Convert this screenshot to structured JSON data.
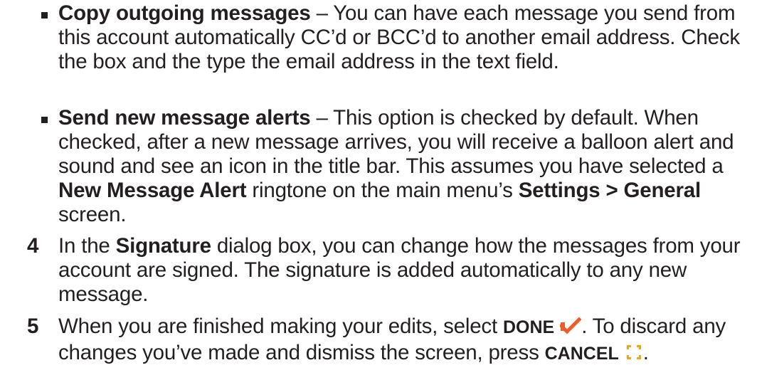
{
  "bullets": [
    {
      "title": "Copy outgoing messages",
      "dash": " – ",
      "text": "You can have each message you send from this account automatically CC’d or BCC’d to another email address. Check the box and the type the email address in the text field."
    },
    {
      "title": "Send new message alerts",
      "dash": " – ",
      "text_a": "This option is checked by default. When checked, after a new message arrives, you will receive a balloon alert and sound and see an icon in the title bar. This assumes you have selected a ",
      "bold_a": "New Message Alert",
      "text_b": " ringtone on the main menu’s ",
      "bold_b": "Settings > General",
      "text_c": " screen."
    }
  ],
  "steps": [
    {
      "number": "4",
      "text_a": "In the ",
      "bold_a": "Signature",
      "text_b": " dialog box, you can change how the messages from your account are signed. The signature is added automatically to any new message."
    },
    {
      "number": "5",
      "text_a": "When you are finished making your edits, select ",
      "done_label": "DONE",
      "text_b": ". To discard any changes you’ve made and dismiss the screen, press ",
      "cancel_label": "CANCEL",
      "text_c": "."
    }
  ],
  "colors": {
    "done_icon": "#f05a28",
    "cancel_icon": "#f7a21b",
    "text": "#231f20"
  },
  "icons": {
    "done": "checkmark-icon",
    "cancel": "cross-icon"
  }
}
